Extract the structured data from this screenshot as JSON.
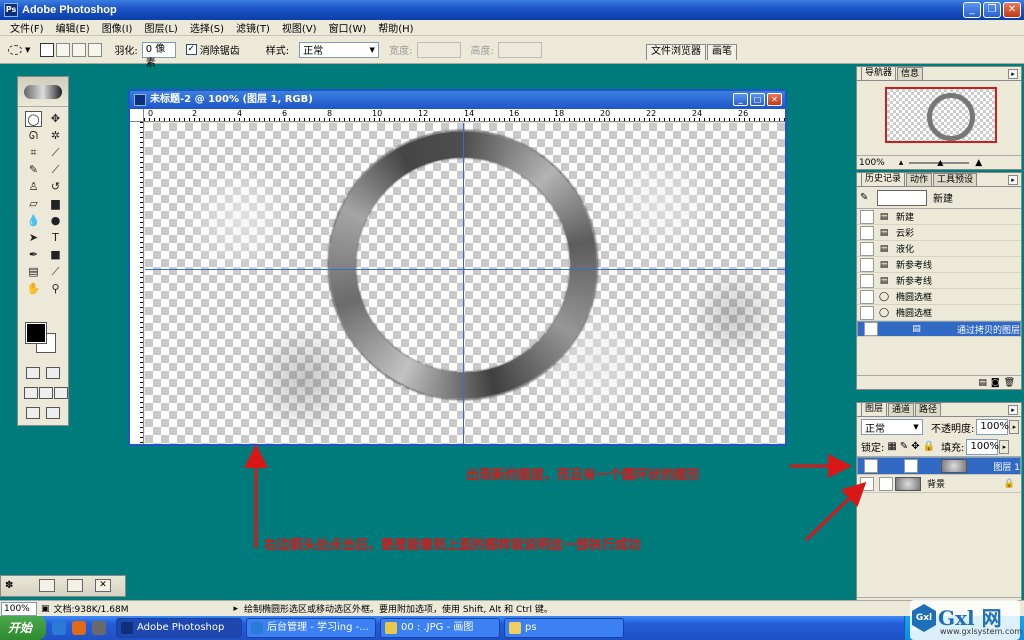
{
  "app": {
    "title": "Adobe Photoshop"
  },
  "menu": [
    "文件(F)",
    "编辑(E)",
    "图像(I)",
    "图层(L)",
    "选择(S)",
    "滤镜(T)",
    "视图(V)",
    "窗口(W)",
    "帮助(H)"
  ],
  "options": {
    "feather_label": "羽化:",
    "feather_value": "0 像素",
    "antialias_label": "消除锯齿",
    "style_label": "样式:",
    "style_value": "正常",
    "width_label": "宽度:",
    "height_label": "高度:",
    "tab_browser": "文件浏览器",
    "tab_brushes": "画笔"
  },
  "document": {
    "title": "未标题-2 @ 100% (图层 1, RGB)",
    "ruler_marks": [
      "0",
      "2",
      "4",
      "6",
      "8",
      "10",
      "12",
      "14",
      "16",
      "18",
      "20",
      "22",
      "24",
      "26"
    ]
  },
  "navigator": {
    "tabs": [
      "导航器",
      "信息"
    ],
    "zoom": "100%"
  },
  "history": {
    "tabs": [
      "历史记录",
      "动作",
      "工具预设"
    ],
    "snapshot": "新建",
    "items": [
      "新建",
      "云彩",
      "液化",
      "新参考线",
      "新参考线",
      "椭圆选框",
      "椭圆选框",
      "通过拷贝的图层"
    ]
  },
  "layers": {
    "tabs": [
      "图层",
      "通道",
      "路径"
    ],
    "blend_mode": "正常",
    "opacity_label": "不透明度:",
    "opacity_value": "100%",
    "lock_label": "锁定:",
    "fill_label": "填充:",
    "fill_value": "100%",
    "items": [
      {
        "name": "图层 1"
      },
      {
        "name": "背景"
      }
    ]
  },
  "annotations": {
    "top": "出现新的图层，而且有一个圆环状的图形",
    "bottom": "右边箭头处点击后，要是能看到上面的图样就说明这一部执行成功"
  },
  "status": {
    "zoom": "100%",
    "doc_size": "文档:938K/1.68M",
    "hint": "绘制椭圆形选区或移动选区外框。要用附加选项，使用 Shift, Alt 和 Ctrl 键。"
  },
  "taskbar": {
    "start": "开始",
    "tasks": [
      "Adobe Photoshop",
      "后台管理 - 学习ing -...",
      "00 : .JPG - 画图",
      "ps"
    ]
  },
  "watermark": {
    "main": "Gxl 网",
    "sub": "www.gxlsystem.com"
  },
  "colors": {
    "desktop": "#007b7b",
    "titlebar": "#1e56c8",
    "annotation": "#d81818",
    "selection": "#316ac5"
  }
}
